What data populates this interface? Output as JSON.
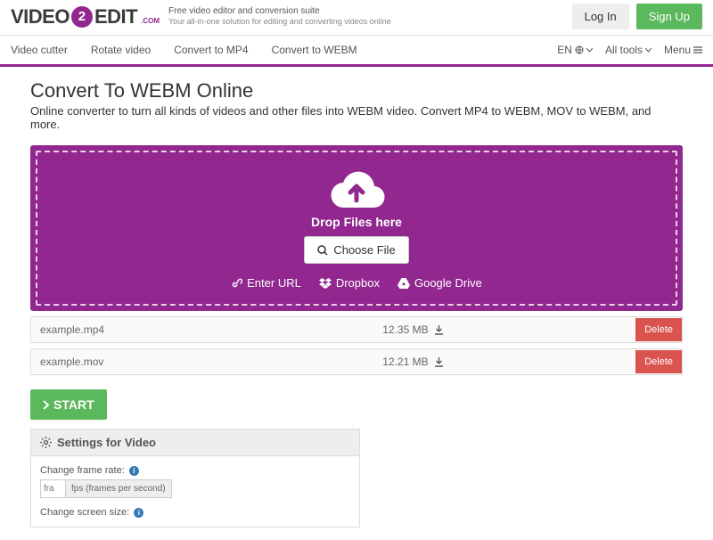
{
  "header": {
    "logo_pre": "VIDEO",
    "logo_mid": "2",
    "logo_post": "EDIT",
    "logo_com": ".COM",
    "tagline1": "Free video editor and conversion suite",
    "tagline2": "Your all-in-one solution for editing and converting videos online",
    "login": "Log In",
    "signup": "Sign Up"
  },
  "nav": {
    "items": [
      "Video cutter",
      "Rotate video",
      "Convert to MP4",
      "Convert to WEBM"
    ],
    "lang": "EN",
    "all_tools": "All tools",
    "menu": "Menu"
  },
  "page": {
    "title": "Convert To WEBM Online",
    "subtitle": "Online converter to turn all kinds of videos and other files into WEBM video. Convert MP4 to WEBM, MOV to WEBM, and more."
  },
  "dropzone": {
    "label": "Drop Files here",
    "choose": "Choose File",
    "enter_url": "Enter URL",
    "dropbox": "Dropbox",
    "gdrive": "Google Drive"
  },
  "files": [
    {
      "name": "example.mp4",
      "size": "12.35 MB",
      "delete": "Delete"
    },
    {
      "name": "example.mov",
      "size": "12.21 MB",
      "delete": "Delete"
    }
  ],
  "start": "START",
  "settings": {
    "head": "Settings for Video",
    "frame_rate_label": "Change frame rate:",
    "fps_placeholder": "fra",
    "fps_unit": "fps (frames per second)",
    "screen_size_label": "Change screen size:"
  }
}
